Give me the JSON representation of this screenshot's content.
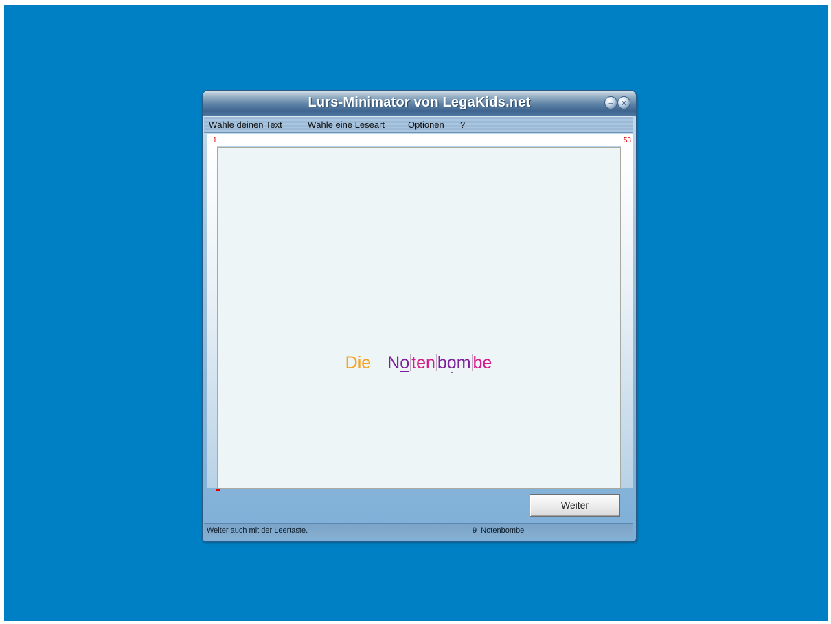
{
  "window": {
    "title": "Lurs-Minimator von LegaKids.net"
  },
  "titlebar_buttons": {
    "minimize_icon": "minimize-circle-icon",
    "close_icon": "close-circle-icon",
    "minimize_glyph": "–",
    "close_glyph": "×"
  },
  "menu": {
    "items": [
      {
        "label": "Wähle deinen Text"
      },
      {
        "label": "Wähle eine Leseart"
      },
      {
        "label": "Optionen"
      },
      {
        "label": "?"
      }
    ]
  },
  "counter": {
    "current": "1",
    "total": "53"
  },
  "reading": {
    "word1": "Die",
    "word2_syllables": [
      {
        "text_a": "N",
        "text_b": "o",
        "vowel": "long"
      },
      {
        "text": "ten"
      },
      {
        "text_a": "b",
        "text_b": "o",
        "text_c": "m",
        "vowel": "short"
      },
      {
        "text": "be"
      }
    ]
  },
  "buttons": {
    "weiter": "Weiter"
  },
  "status": {
    "hint": "Weiter auch mit der Leertaste.",
    "position": "9",
    "word": "Notenbombe"
  },
  "colors": {
    "desktop": "#0080c4",
    "word_orange": "#f7a11c",
    "word_purple": "#7d1f9c",
    "word_magenta": "#d61a8c",
    "counter_red": "#e60000"
  }
}
